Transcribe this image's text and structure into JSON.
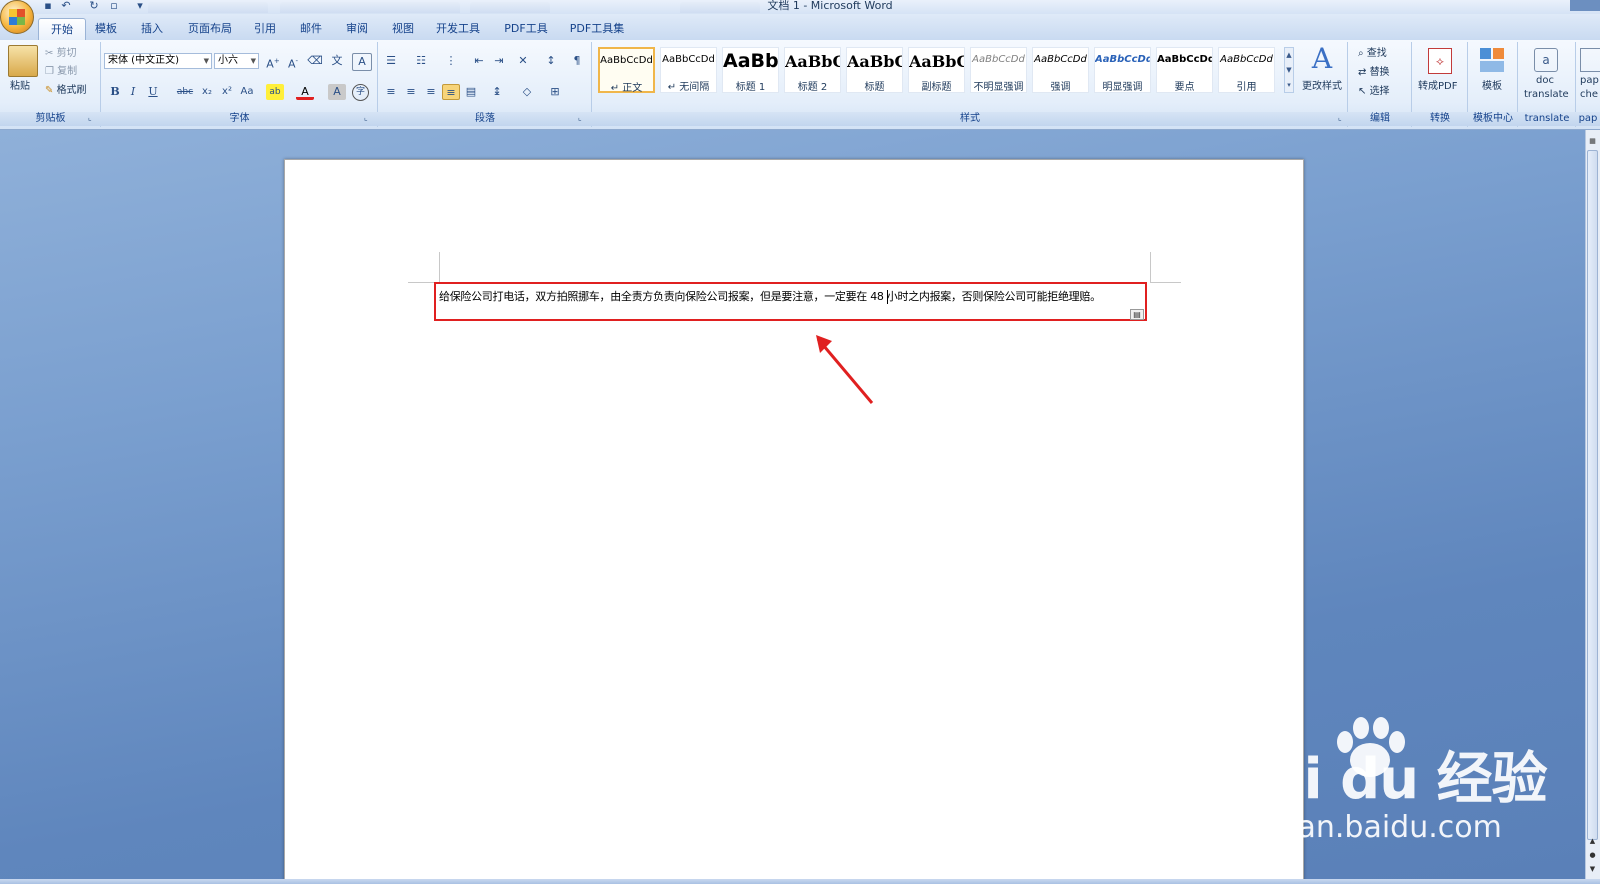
{
  "window": {
    "title": "文档 1 - Microsoft Word"
  },
  "qat": [
    "save-icon",
    "undo-icon",
    "redo-icon",
    "print-preview-icon"
  ],
  "tabs": [
    {
      "label": "开始",
      "active": true
    },
    {
      "label": "模板"
    },
    {
      "label": "插入"
    },
    {
      "label": "页面布局"
    },
    {
      "label": "引用"
    },
    {
      "label": "邮件"
    },
    {
      "label": "审阅"
    },
    {
      "label": "视图"
    },
    {
      "label": "开发工具"
    },
    {
      "label": "PDF工具"
    },
    {
      "label": "PDF工具集"
    }
  ],
  "clipboard": {
    "paste": "粘贴",
    "cut": "剪切",
    "copy": "复制",
    "format_painter": "格式刷",
    "group": "剪贴板"
  },
  "font": {
    "name": "宋体 (中文正文)",
    "size": "小六",
    "group": "字体"
  },
  "paragraph": {
    "group": "段落"
  },
  "styles": {
    "group": "样式",
    "items": [
      {
        "sample": "AaBbCcDd",
        "name": "↵ 正文",
        "selected": true
      },
      {
        "sample": "AaBbCcDd",
        "name": "↵ 无间隔"
      },
      {
        "sample": "AaBb",
        "name": "标题 1"
      },
      {
        "sample": "AaBbC",
        "name": "标题 2"
      },
      {
        "sample": "AaBbC",
        "name": "标题"
      },
      {
        "sample": "AaBbC",
        "name": "副标题"
      },
      {
        "sample": "AaBbCcDd",
        "name": "不明显强调"
      },
      {
        "sample": "AaBbCcDd",
        "name": "强调"
      },
      {
        "sample": "AaBbCcDd",
        "name": "明显强调"
      },
      {
        "sample": "AaBbCcDd",
        "name": "要点"
      },
      {
        "sample": "AaBbCcDd",
        "name": "引用"
      }
    ],
    "change_styles": "更改样式"
  },
  "editing": {
    "find": "查找",
    "replace": "替换",
    "select": "选择",
    "group": "编辑"
  },
  "convert": {
    "to_pdf": "转成PDF",
    "group": "转换"
  },
  "template_center": {
    "label": "模板",
    "group": "模板中心"
  },
  "translate": {
    "label_line1": "doc",
    "label_line2": "translate",
    "group": "translate"
  },
  "paper": {
    "label_line1": "pap",
    "label_line2": "che",
    "group": "pap"
  },
  "document": {
    "text": "给保险公司打电话，双方拍照挪车，由全责方负责向保险公司报案，但是要注意，一定要在 48 小时之内报案，否则保险公司可能拒绝理赔。"
  },
  "watermark": {
    "brand": "Bai du 经验",
    "url": "jingyan.baidu.com"
  },
  "colors": {
    "accent_red": "#e02020",
    "ribbon_blue": "#15428b"
  }
}
